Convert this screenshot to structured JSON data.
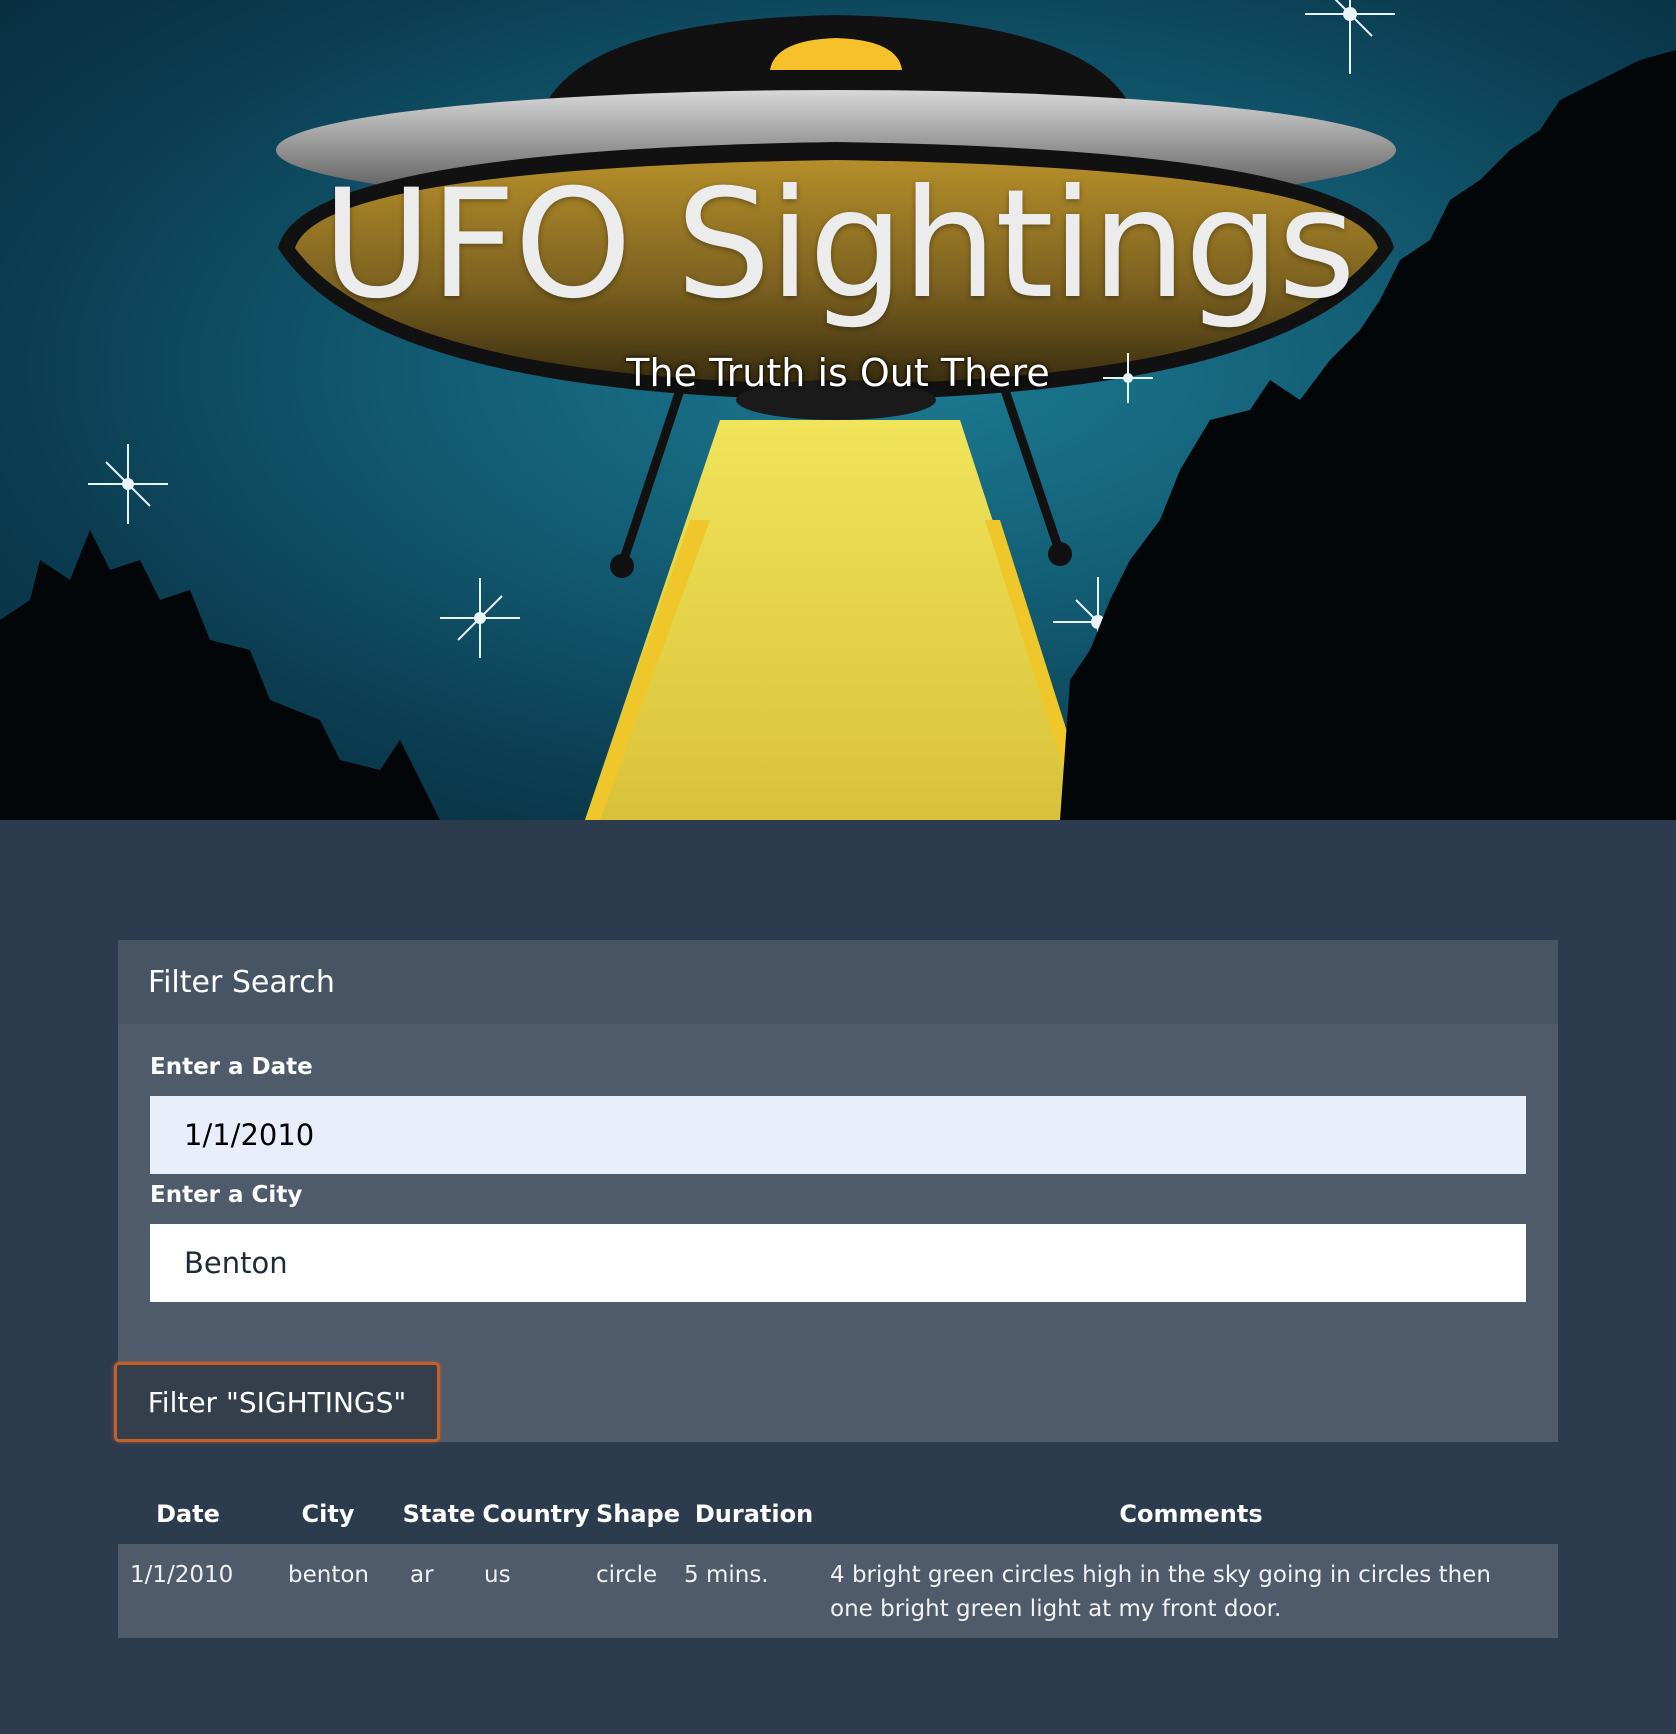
{
  "hero": {
    "title": "UFO Sightings",
    "subtitle": "The Truth is Out There"
  },
  "filter_panel": {
    "header": "Filter Search",
    "date_label": "Enter a Date",
    "date_value": "1/1/2010",
    "city_label": "Enter a City",
    "city_value": "Benton",
    "button_label": "Filter \"SIGHTINGS\""
  },
  "table": {
    "columns": [
      "Date",
      "City",
      "State",
      "Country",
      "Shape",
      "Duration",
      "Comments"
    ],
    "rows": [
      {
        "date": "1/1/2010",
        "city": "benton",
        "state": "ar",
        "country": "us",
        "shape": "circle",
        "duration": "5 mins.",
        "comments": "4 bright green circles high in the sky going in circles then one bright green light at my front door."
      }
    ]
  },
  "colors": {
    "page_background": "#2d3b4e",
    "panel_background": "#4f5b6b",
    "panel_header": "#475464",
    "button_border": "#c2622a",
    "sky": "#135e75",
    "ufo_light": "#f4d63a"
  }
}
